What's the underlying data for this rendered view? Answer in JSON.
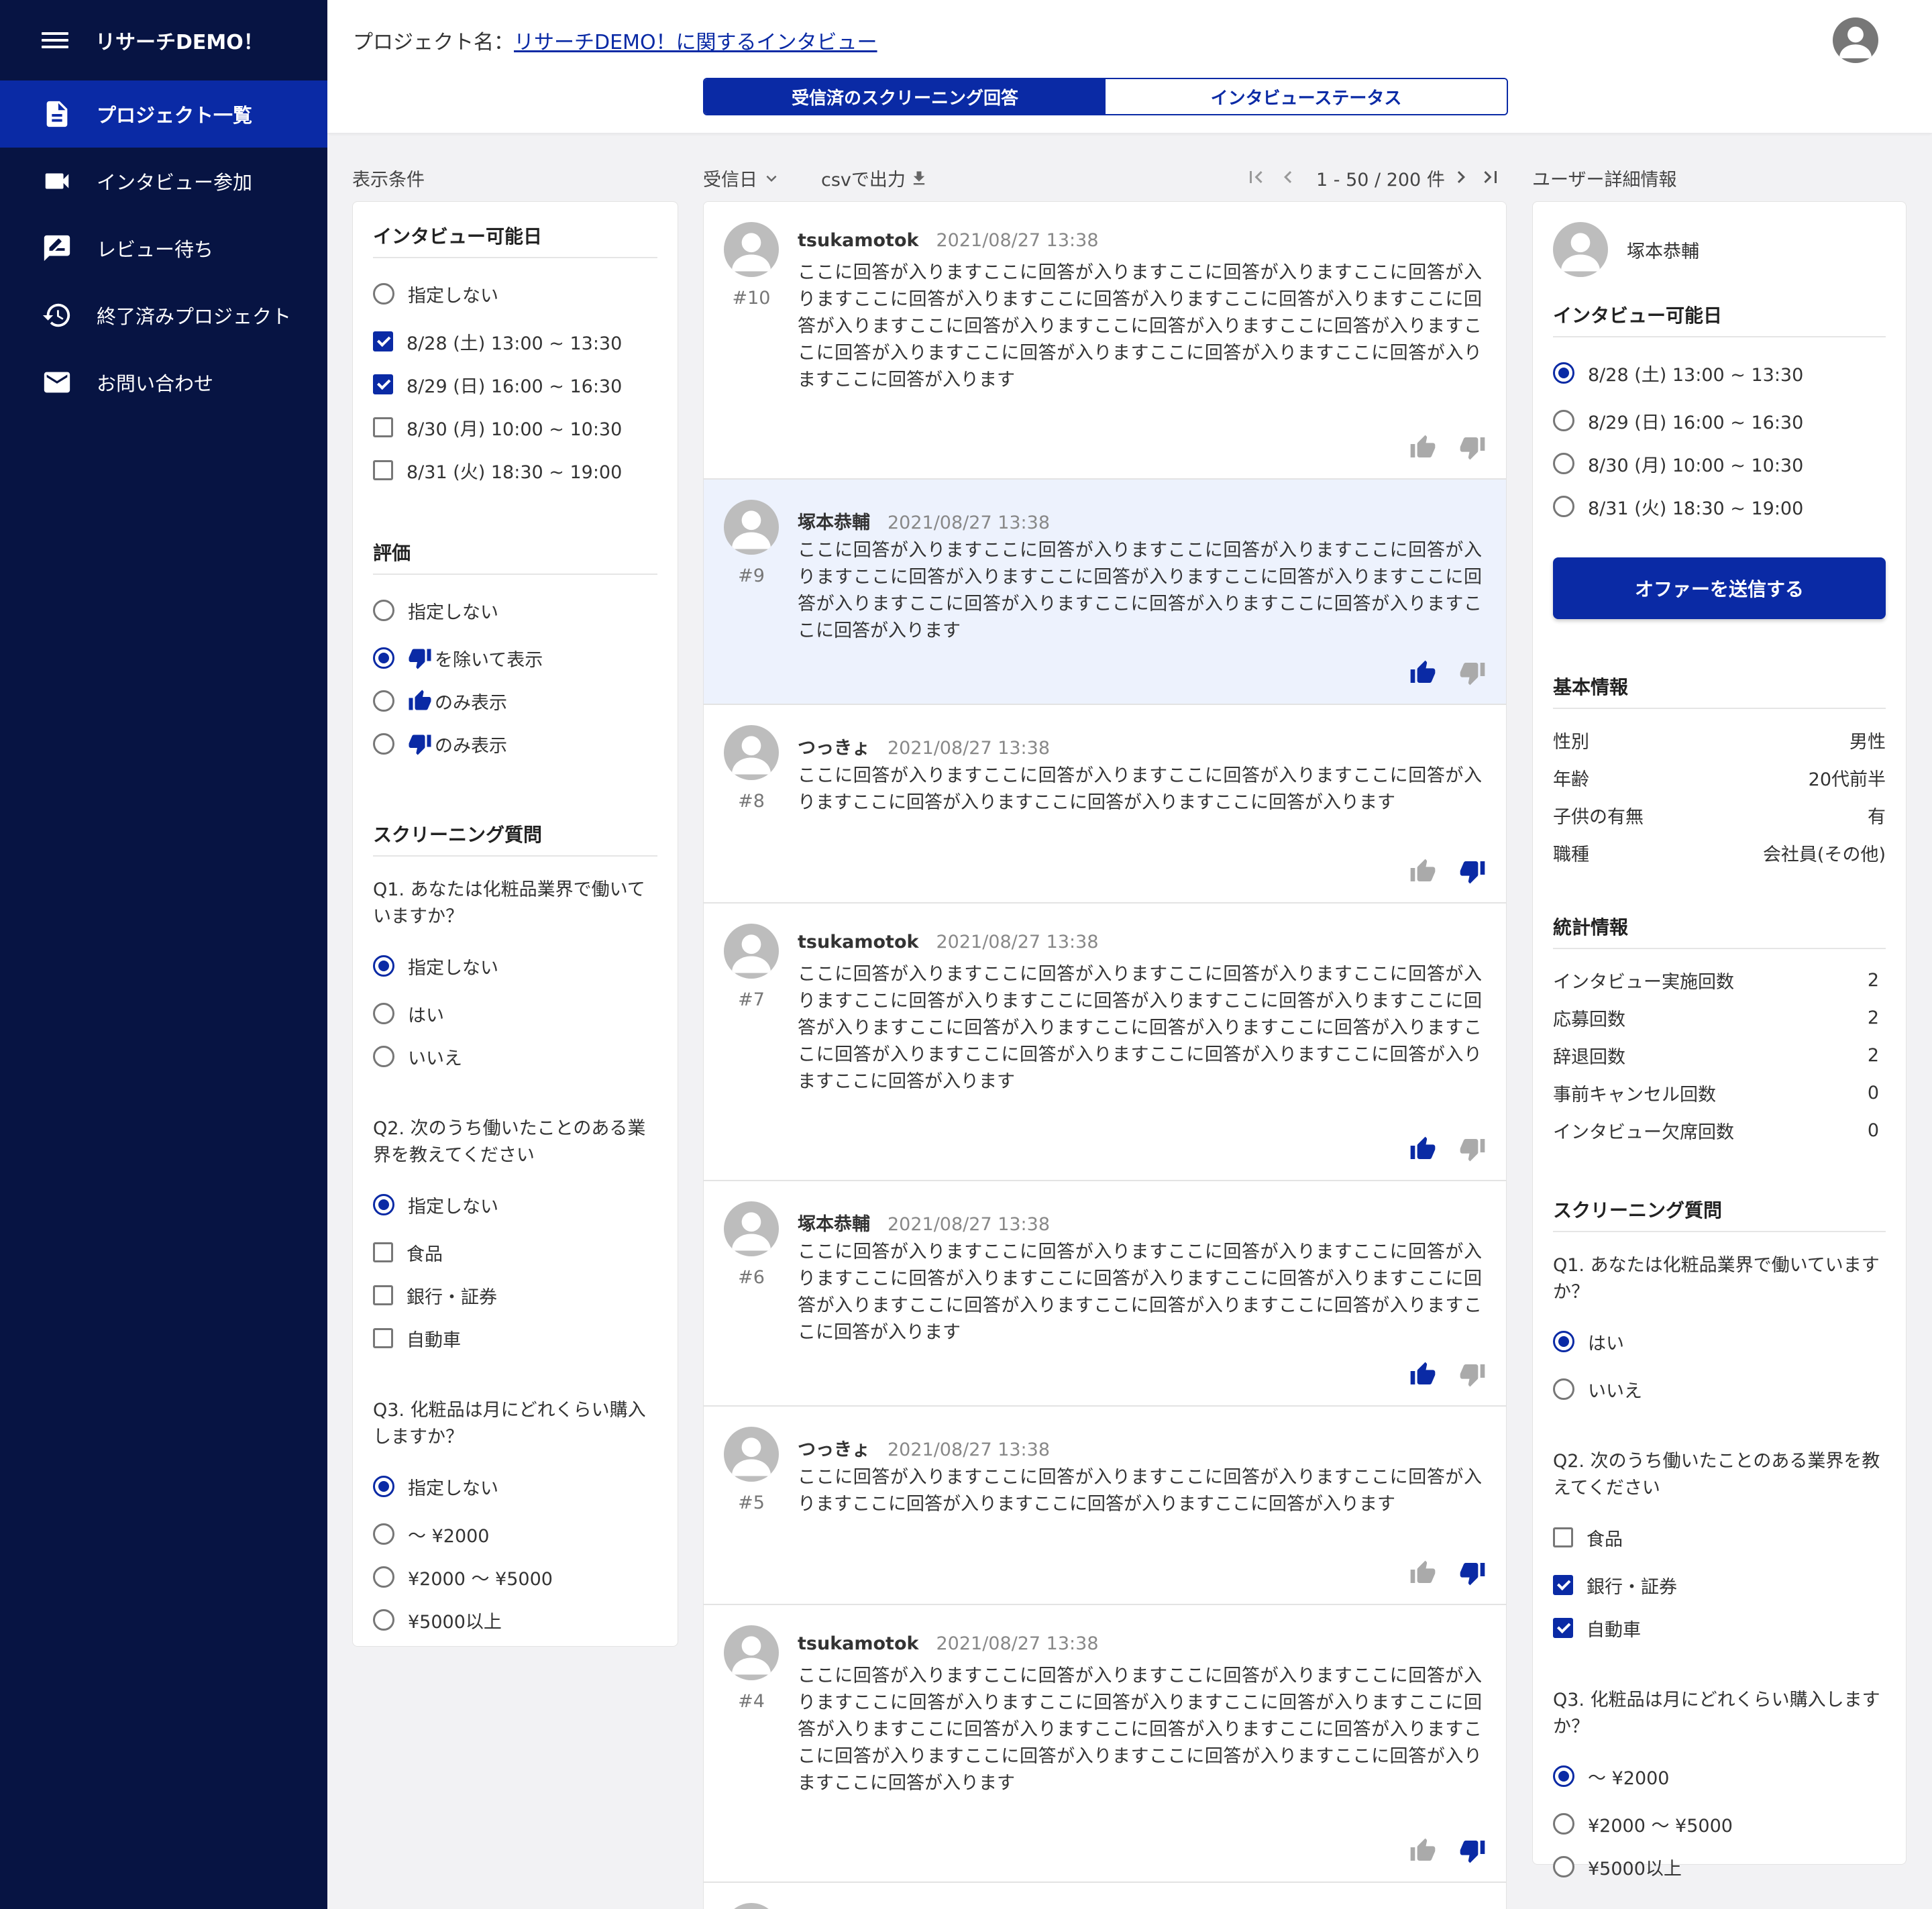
{
  "app": {
    "title": "リサーチDEMO！"
  },
  "sidebar": {
    "items": [
      {
        "label": "プロジェクト一覧",
        "icon": "document-icon"
      },
      {
        "label": "インタビュー参加",
        "icon": "video-camera-icon"
      },
      {
        "label": "レビュー待ち",
        "icon": "rate-review-icon"
      },
      {
        "label": "終了済みプロジェクト",
        "icon": "history-icon"
      },
      {
        "label": "お問い合わせ",
        "icon": "mail-icon"
      }
    ]
  },
  "header": {
    "project_prefix": "プロジェクト名：",
    "project_name": "リサーチDEMO！に関するインタビュー",
    "tabs": [
      {
        "label": "受信済のスクリーニング回答",
        "active": true
      },
      {
        "label": "インタビューステータス",
        "active": false
      }
    ]
  },
  "filters": {
    "section_label": "表示条件",
    "availability": {
      "title": "インタビュー可能日",
      "none_label": "指定しない",
      "options": [
        "8/28 (土) 13:00 ~ 13:30",
        "8/29 (日) 16:00 ~ 16:30",
        "8/30 (月) 10:00 ~ 10:30",
        "8/31 (火) 18:30 ~ 19:00"
      ],
      "checked": [
        true,
        true,
        false,
        false
      ]
    },
    "rating": {
      "title": "評価",
      "options": [
        "指定しない",
        "を除いて表示",
        "のみ表示",
        "のみ表示"
      ],
      "selected_index": 1
    },
    "screening": {
      "title": "スクリーニング質問",
      "q1": {
        "text": "Q1. あなたは化粧品業界で働いていますか？",
        "options": [
          "指定しない",
          "はい",
          "いいえ"
        ]
      },
      "q2": {
        "text": "Q2. 次のうち働いたことのある業界を教えてください",
        "none_label": "指定しない",
        "options": [
          "食品",
          "銀行・証券",
          "自動車"
        ]
      },
      "q3": {
        "text": "Q3. 化粧品は月にどれくらい購入しますか？",
        "options": [
          "指定しない",
          "〜 ¥2000",
          "¥2000 〜 ¥5000",
          "¥5000以上"
        ]
      }
    }
  },
  "toolbar": {
    "sort_label": "受信日",
    "csv_label": "csvで出力",
    "pagination": "1 - 50 / 200 件"
  },
  "responses": [
    {
      "num": "#10",
      "name": "tsukamotok",
      "date": "2021/08/27 13:38",
      "text": "ここに回答が入りますここに回答が入りますここに回答が入りますここに回答が入りますここに回答が入りますここに回答が入りますここに回答が入りますここに回答が入りますここに回答が入りますここに回答が入りますここに回答が入りますここに回答が入りますここに回答が入りますここに回答が入りますここに回答が入りますここに回答が入ります",
      "vote": "none"
    },
    {
      "num": "#9",
      "name": "塚本恭輔",
      "date": "2021/08/27 13:38",
      "text": "ここに回答が入りますここに回答が入りますここに回答が入りますここに回答が入りますここに回答が入りますここに回答が入りますここに回答が入りますここに回答が入りますここに回答が入りますここに回答が入りますここに回答が入りますここに回答が入ります",
      "vote": "up"
    },
    {
      "num": "#8",
      "name": "つっきょ",
      "date": "2021/08/27 13:38",
      "text": "ここに回答が入りますここに回答が入りますここに回答が入りますここに回答が入りますここに回答が入りますここに回答が入りますここに回答が入ります",
      "vote": "down"
    },
    {
      "num": "#7",
      "name": "tsukamotok",
      "date": "2021/08/27 13:38",
      "text": "ここに回答が入りますここに回答が入りますここに回答が入りますここに回答が入りますここに回答が入りますここに回答が入りますここに回答が入りますここに回答が入りますここに回答が入りますここに回答が入りますここに回答が入りますここに回答が入りますここに回答が入りますここに回答が入りますここに回答が入りますここに回答が入ります",
      "vote": "up"
    },
    {
      "num": "#6",
      "name": "塚本恭輔",
      "date": "2021/08/27 13:38",
      "text": "ここに回答が入りますここに回答が入りますここに回答が入りますここに回答が入りますここに回答が入りますここに回答が入りますここに回答が入りますここに回答が入りますここに回答が入りますここに回答が入りますここに回答が入りますここに回答が入ります",
      "vote": "up"
    },
    {
      "num": "#5",
      "name": "つっきょ",
      "date": "2021/08/27 13:38",
      "text": "ここに回答が入りますここに回答が入りますここに回答が入りますここに回答が入りますここに回答が入りますここに回答が入りますここに回答が入ります",
      "vote": "down"
    },
    {
      "num": "#4",
      "name": "tsukamotok",
      "date": "2021/08/27 13:38",
      "text": "ここに回答が入りますここに回答が入りますここに回答が入りますここに回答が入りますここに回答が入りますここに回答が入りますここに回答が入りますここに回答が入りますここに回答が入りますここに回答が入りますここに回答が入りますここに回答が入りますここに回答が入りますここに回答が入りますここに回答が入りますここに回答が入ります",
      "vote": "down"
    }
  ],
  "detail": {
    "section_label": "ユーザー詳細情報",
    "user_name": "塚本恭輔",
    "availability": {
      "title": "インタビュー可能日",
      "options": [
        "8/28 (土) 13:00 ~ 13:30",
        "8/29 (日) 16:00 ~ 16:30",
        "8/30 (月) 10:00 ~ 10:30",
        "8/31 (火) 18:30 ~ 19:00"
      ],
      "selected_index": 0
    },
    "offer_button": "オファーを送信する",
    "basic": {
      "title": "基本情報",
      "rows": [
        {
          "k": "性別",
          "v": "男性"
        },
        {
          "k": "年齢",
          "v": "20代前半"
        },
        {
          "k": "子供の有無",
          "v": "有"
        },
        {
          "k": "職種",
          "v": "会社員(その他)"
        }
      ]
    },
    "stats": {
      "title": "統計情報",
      "rows": [
        {
          "k": "インタビュー実施回数",
          "v": "2"
        },
        {
          "k": "応募回数",
          "v": "2"
        },
        {
          "k": "辞退回数",
          "v": "2"
        },
        {
          "k": "事前キャンセル回数",
          "v": "0"
        },
        {
          "k": "インタビュー欠席回数",
          "v": "0"
        }
      ]
    },
    "screening": {
      "title": "スクリーニング質問",
      "q1": {
        "text": "Q1. あなたは化粧品業界で働いていますか？",
        "options": [
          "はい",
          "いいえ"
        ]
      },
      "q2": {
        "text": "Q2. 次のうち働いたことのある業界を教えてください",
        "options": [
          "食品",
          "銀行・証券",
          "自動車"
        ],
        "checked": [
          false,
          true,
          true
        ]
      },
      "q3": {
        "text": "Q3. 化粧品は月にどれくらい購入しますか？",
        "options": [
          "〜 ¥2000",
          "¥2000 〜 ¥5000",
          "¥5000以上"
        ]
      }
    }
  },
  "colors": {
    "sidebar": "#071443",
    "accent": "#0a2aa5",
    "selected_row": "#edf2fd"
  }
}
